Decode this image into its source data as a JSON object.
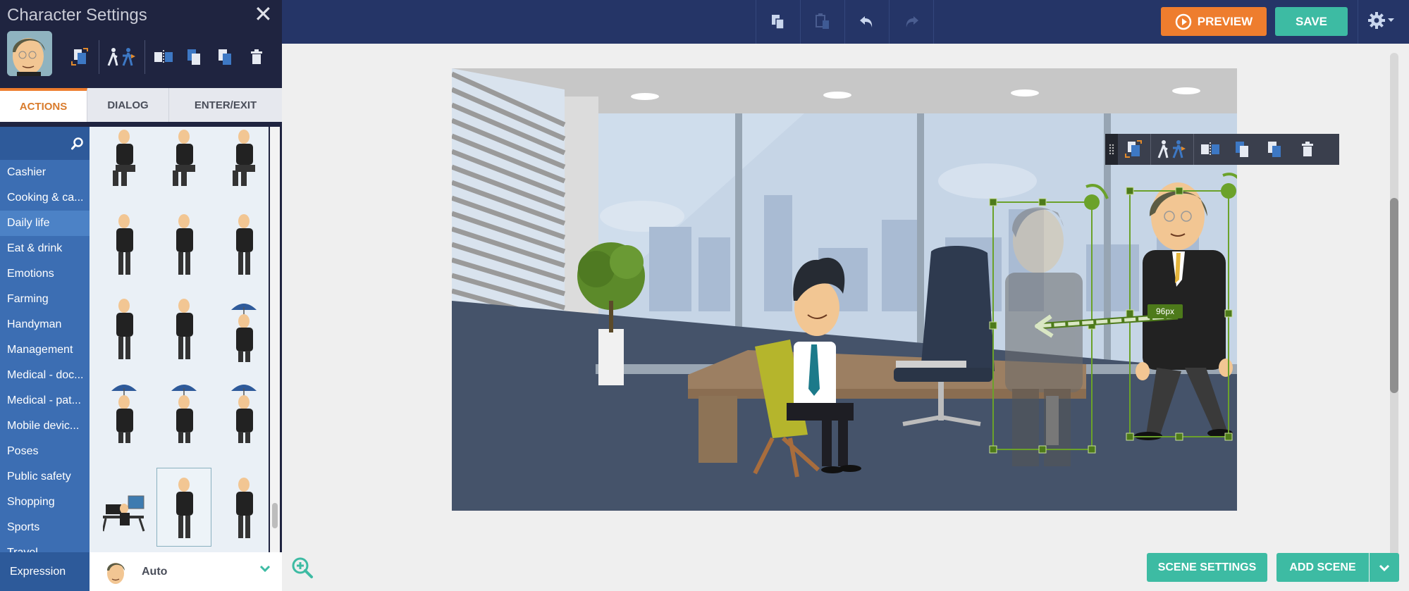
{
  "topbar": {
    "tools": [
      {
        "name": "copy-icon",
        "label": "Copy"
      },
      {
        "name": "paste-icon",
        "label": "Paste"
      },
      {
        "name": "undo-icon",
        "label": "Undo"
      },
      {
        "name": "redo-icon",
        "label": "Redo"
      }
    ],
    "preview_label": "PREVIEW",
    "save_label": "SAVE",
    "colors": {
      "bar": "#253567",
      "preview": "#ee7d2e",
      "save": "#3dbba3"
    }
  },
  "panel": {
    "title": "Character Settings",
    "close_glyph": "✕",
    "tabs": [
      {
        "label": "ACTIONS",
        "active": true
      },
      {
        "label": "DIALOG",
        "active": false
      },
      {
        "label": "ENTER/EXIT",
        "active": false
      }
    ],
    "categories": [
      {
        "label": "Cashier",
        "active": false
      },
      {
        "label": "Cooking & ca...",
        "active": false
      },
      {
        "label": "Daily life",
        "active": true
      },
      {
        "label": "Eat & drink",
        "active": false
      },
      {
        "label": "Emotions",
        "active": false
      },
      {
        "label": "Farming",
        "active": false
      },
      {
        "label": "Handyman",
        "active": false
      },
      {
        "label": "Management",
        "active": false
      },
      {
        "label": "Medical - doc...",
        "active": false
      },
      {
        "label": "Medical - pat...",
        "active": false
      },
      {
        "label": "Mobile devic...",
        "active": false
      },
      {
        "label": "Poses",
        "active": false
      },
      {
        "label": "Public safety",
        "active": false
      },
      {
        "label": "Shopping",
        "active": false
      },
      {
        "label": "Sports",
        "active": false
      },
      {
        "label": "Travel",
        "active": false
      }
    ],
    "thumbnails": [
      "sitting-pose",
      "sitting-pose-hands-knees",
      "sitting-pose-thinking",
      "standing-pose",
      "arms-crossed-laughing",
      "hands-clasped",
      "phone-call-hand-to-ear",
      "phone-call-bent",
      "broken-umbrella-small",
      "umbrella-rain",
      "broken-umbrella-walking",
      "umbrella-walking",
      "working-at-desk",
      "walking",
      "running"
    ],
    "selected_thumbnail": "walking",
    "expression_label": "Expression",
    "expression_value": "Auto"
  },
  "canvas": {
    "distance_label": "96px",
    "scene_settings_label": "SCENE SETTINGS",
    "add_scene_label": "ADD SCENE"
  }
}
